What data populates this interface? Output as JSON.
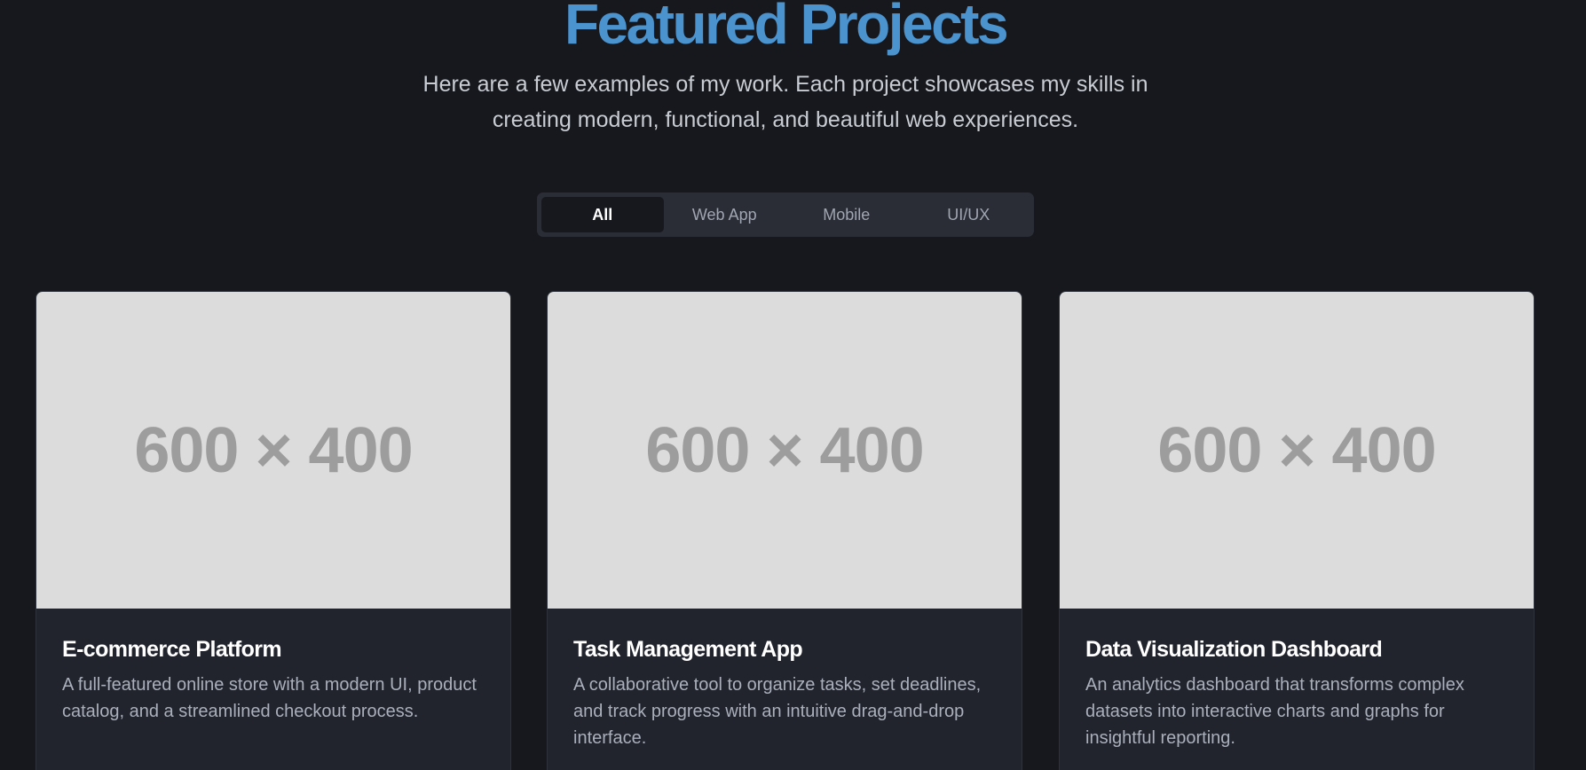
{
  "header": {
    "title": "Featured Projects",
    "subtitle": "Here are a few examples of my work. Each project showcases my skills in creating modern, functional, and beautiful web experiences."
  },
  "filters": {
    "active": "All",
    "items": [
      {
        "label": "All"
      },
      {
        "label": "Web App"
      },
      {
        "label": "Mobile"
      },
      {
        "label": "UI/UX"
      }
    ]
  },
  "projects": [
    {
      "image_placeholder": "600 × 400",
      "title": "E-commerce Platform",
      "description": "A full-featured online store with a modern UI, product catalog, and a streamlined checkout process."
    },
    {
      "image_placeholder": "600 × 400",
      "title": "Task Management App",
      "description": "A collaborative tool to organize tasks, set deadlines, and track progress with an intuitive drag-and-drop interface."
    },
    {
      "image_placeholder": "600 × 400",
      "title": "Data Visualization Dashboard",
      "description": "An analytics dashboard that transforms complex datasets into interactive charts and graphs for insightful reporting."
    }
  ],
  "colors": {
    "background": "#16181e",
    "accent": "#4a93cf",
    "card": "#21242d",
    "placeholder": "#dcdcdc"
  }
}
